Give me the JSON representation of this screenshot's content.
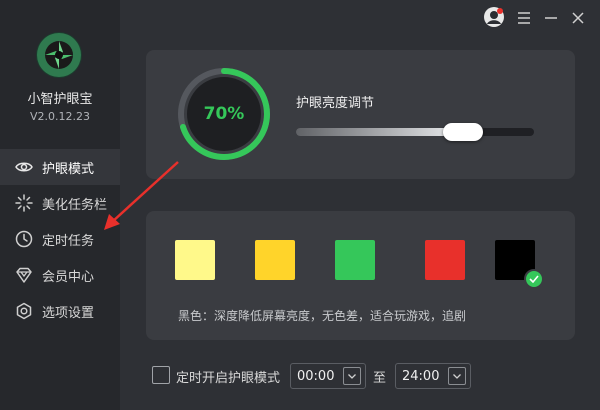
{
  "app": {
    "name": "小智护眼宝",
    "version": "V2.0.12.23"
  },
  "window_controls": {
    "avatar_icon": "avatar-icon",
    "menu_icon": "menu-icon",
    "minimize_icon": "minimize-icon",
    "close_icon": "close-icon"
  },
  "sidebar": {
    "items": [
      {
        "label": "护眼模式",
        "icon": "eye-icon",
        "active": true
      },
      {
        "label": "美化任务栏",
        "icon": "sparkle-icon",
        "active": false
      },
      {
        "label": "定时任务",
        "icon": "clock-icon",
        "active": false
      },
      {
        "label": "会员中心",
        "icon": "diamond-icon",
        "active": false
      },
      {
        "label": "选项设置",
        "icon": "settings-icon",
        "active": false
      }
    ]
  },
  "brightness": {
    "percent_text": "70%",
    "value": 0.7,
    "label": "护眼亮度调节",
    "slider_value": 0.7
  },
  "colors": {
    "swatches": [
      "#fff98a",
      "#ffd42a",
      "#35c75a",
      "#e8302b",
      "#000000"
    ],
    "selected_index": 4,
    "description": "黑色：深度降低屏幕亮度，无色差，适合玩游戏，追剧"
  },
  "timer": {
    "checkbox_label": "定时开启护眼模式",
    "checked": false,
    "start": "00:00",
    "to_label": "至",
    "end": "24:00"
  },
  "accent_color": "#35c75a"
}
